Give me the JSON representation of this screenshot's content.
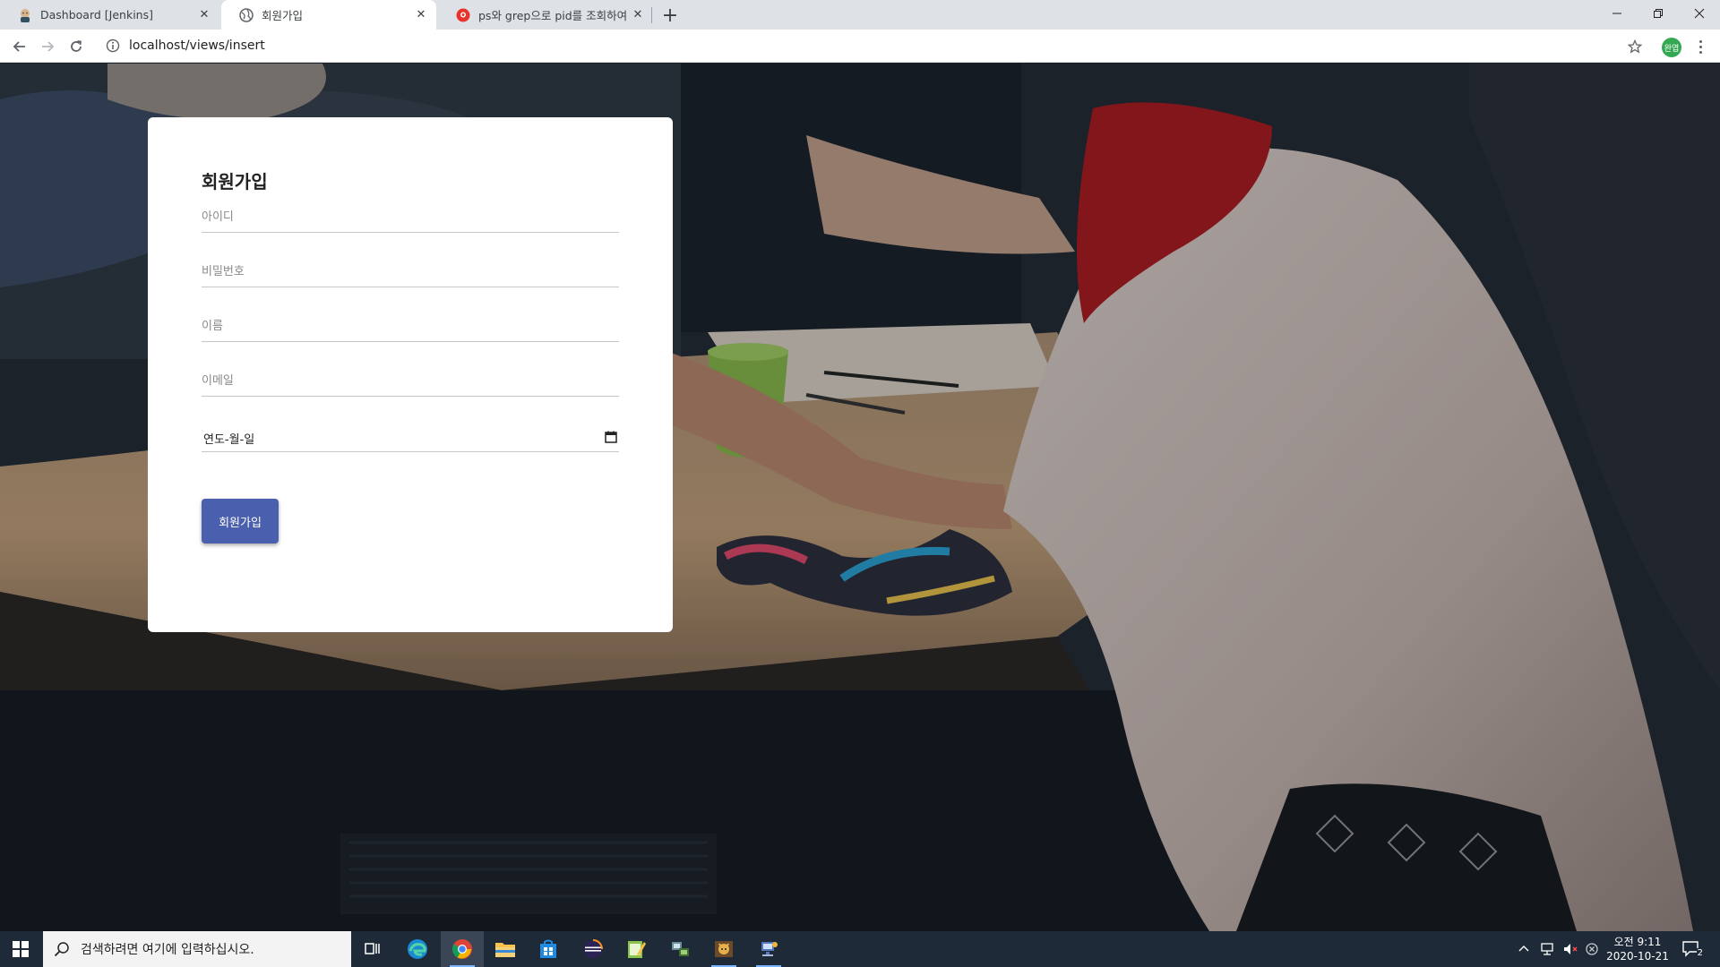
{
  "browser": {
    "tabs": [
      {
        "title": "Dashboard [Jenkins]",
        "favicon": "jenkins-icon",
        "active": false
      },
      {
        "title": "회원가입",
        "favicon": "globe-icon",
        "active": true
      },
      {
        "title": "ps와 grep으로 pid를 조회하여 프",
        "favicon": "blog-icon",
        "active": false
      }
    ],
    "address": "localhost/views/insert",
    "profile_initial": "완엽"
  },
  "form": {
    "title": "회원가입",
    "id_placeholder": "아이디",
    "password_placeholder": "비밀번호",
    "name_placeholder": "이름",
    "email_placeholder": "이메일",
    "date_placeholder": "연도-월-일",
    "submit_label": "회원가입",
    "accent_color": "#4a5fad"
  },
  "taskbar": {
    "search_placeholder": "검색하려면 여기에 입력하십시오.",
    "time": "오전 9:11",
    "date": "2020-10-21",
    "notification_count": "2"
  }
}
